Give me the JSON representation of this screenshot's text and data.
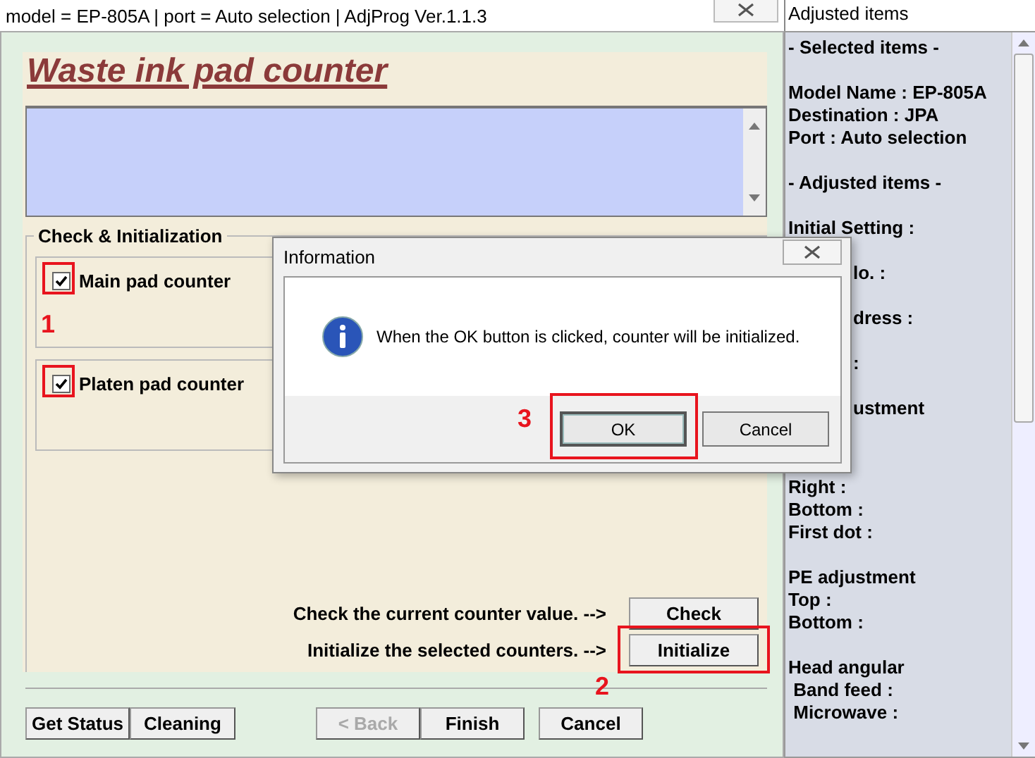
{
  "window": {
    "title": "model = EP-805A | port = Auto selection | AdjProg Ver.1.1.3"
  },
  "heading": "Waste ink pad counter",
  "group": {
    "title": "Check & Initialization",
    "counters": [
      {
        "label": "Main pad counter",
        "checked": true,
        "highlighted": true,
        "marker": "1"
      },
      {
        "label": "Platen pad counter",
        "checked": true,
        "highlighted": true
      }
    ]
  },
  "actions": [
    {
      "text": "Check the current counter value. -->",
      "button": "Check",
      "highlighted": false
    },
    {
      "text": "Initialize the selected counters. -->",
      "button": "Initialize",
      "highlighted": true,
      "marker": "2"
    }
  ],
  "footer_buttons": [
    {
      "label": "Get Status",
      "disabled": false
    },
    {
      "label": "Cleaning",
      "disabled": false
    },
    {
      "label": "< Back",
      "disabled": true
    },
    {
      "label": "Finish",
      "disabled": false
    },
    {
      "label": "Cancel",
      "disabled": false
    }
  ],
  "side_panel": {
    "title": "Adjusted items",
    "groups": [
      [
        {
          "text": "- Selected items -",
          "kind": "full"
        }
      ],
      [
        {
          "text": "Model Name : EP-805A",
          "kind": "full"
        },
        {
          "text": "Destination : JPA",
          "kind": "full"
        },
        {
          "text": "Port : Auto selection",
          "kind": "full"
        }
      ],
      [
        {
          "text": "- Adjusted items -",
          "kind": "full"
        }
      ],
      [
        {
          "text": "Initial Setting :",
          "kind": "full"
        }
      ],
      [
        {
          "text": "lo. :",
          "kind": "partial"
        }
      ],
      [
        {
          "text": "dress :",
          "kind": "partial"
        }
      ],
      [
        {
          "text": ":",
          "kind": "partial"
        }
      ],
      [
        {
          "text": "ustment",
          "kind": "partial"
        },
        {
          "text": "Right :",
          "kind": "after-dialog"
        },
        {
          "text": "Bottom :",
          "kind": "full"
        },
        {
          "text": "First dot :",
          "kind": "full"
        }
      ],
      [
        {
          "text": "PE adjustment",
          "kind": "full"
        },
        {
          "text": "Top :",
          "kind": "full"
        },
        {
          "text": "Bottom :",
          "kind": "full"
        }
      ],
      [
        {
          "text": "Head angular",
          "kind": "full"
        },
        {
          "text": " Band feed :",
          "kind": "full"
        },
        {
          "text": " Microwave :",
          "kind": "full"
        }
      ]
    ]
  },
  "dialog": {
    "title": "Information",
    "message": "When the OK button is clicked, counter will be initialized.",
    "buttons": [
      {
        "label": "OK",
        "highlighted": true,
        "marker": "3"
      },
      {
        "label": "Cancel",
        "highlighted": false
      }
    ]
  }
}
